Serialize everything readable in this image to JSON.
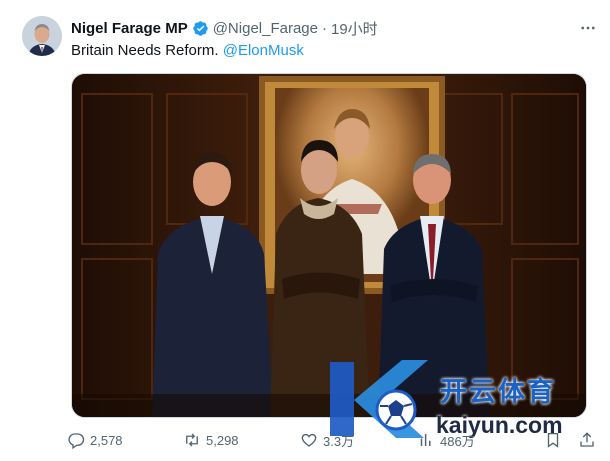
{
  "author": {
    "display_name": "Nigel Farage MP",
    "handle": "@Nigel_Farage",
    "separator": "·",
    "time": "19小时",
    "verified_icon": "verified-badge-icon"
  },
  "tweet": {
    "text_prefix": "Britain Needs Reform.",
    "mention": "@ElonMusk"
  },
  "media": {
    "alt": "Photo of three men standing in front of a portrait in a wood-panelled room"
  },
  "actions": {
    "replies": "2,578",
    "retweets": "5,298",
    "likes": "3.3万",
    "views": "486万"
  },
  "watermark": {
    "cn_text": "开云体育",
    "en_text": "kaiyun.com"
  },
  "colors": {
    "accent": "#1d9bf0",
    "text": "#0f1419",
    "secondary": "#536471"
  }
}
